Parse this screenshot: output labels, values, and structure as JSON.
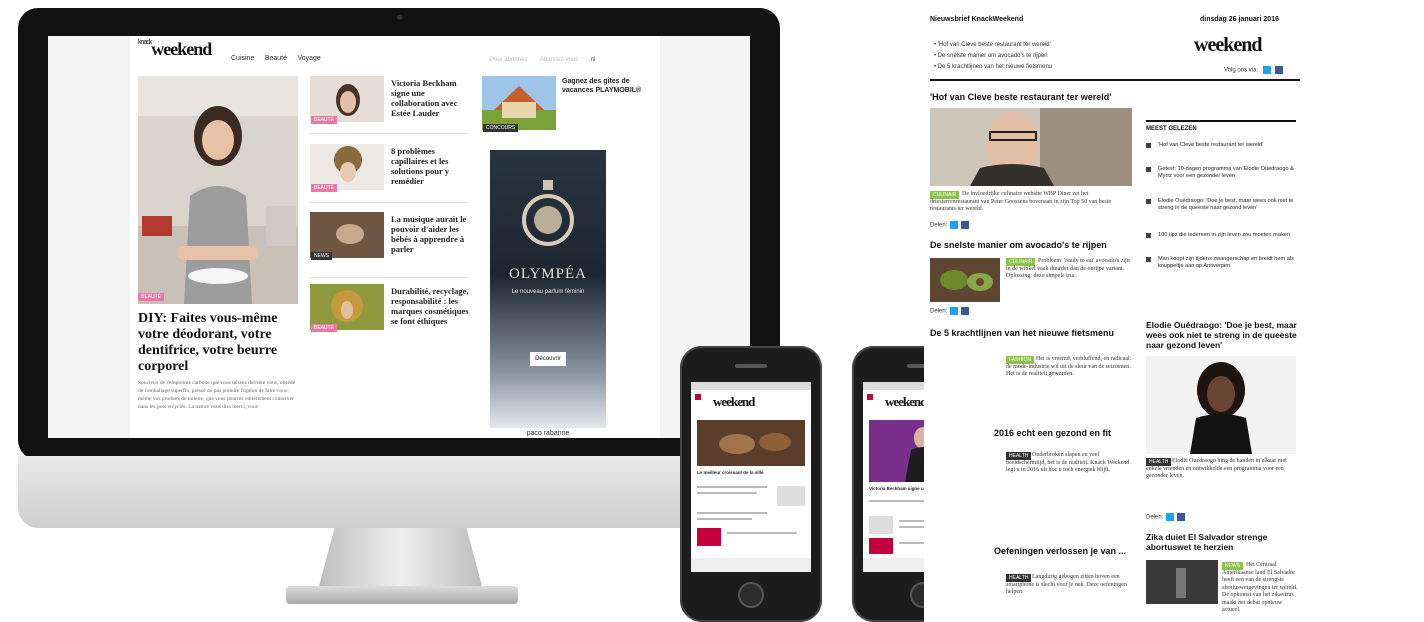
{
  "desktop": {
    "logo": "weekend",
    "logo_prefix": "knack",
    "nav": [
      "Cuisine",
      "Beauté",
      "Voyage"
    ],
    "header_right": [
      "Pour abonnés",
      "Abonnez-vous",
      "nl"
    ],
    "feature": {
      "tag": "BEAUTÉ",
      "title": "DIY: Faites vous-même votre déodorant, votre dentifrice, votre beurre corporel",
      "excerpt": "Soucieux de l'empreinte carbone que vous laissez derrière vous, obsédé de l'emballage superflu, pressé ou pas prendre l'option de faire vous-même vos produits de toilette, que vous pourrez entièrement conserver dans les pots recyclés. La nature vous dira merci, vous"
    },
    "items": [
      {
        "title": "Victoria Beckham signe une collaboration avec Estée Lauder",
        "tag": "BEAUTÉ"
      },
      {
        "title": "8 problèmes capillaires et les solutions pour y remédier",
        "tag": "BEAUTÉ"
      },
      {
        "title": "La musique aurait le pouvoir d'aider les bébés à apprendre à parler",
        "tag": "NEWS"
      },
      {
        "title": "Durabilité, recyclage, responsabilité : les marques cosmétiques se font éthiques",
        "tag": "BEAUTÉ"
      }
    ],
    "promo": {
      "title": "Gagnez des gîtes de vacances PLAYMOBIL®",
      "tag": "CONCOURS"
    },
    "ad": {
      "brand": "OLYMPÉA",
      "subtitle": "Le nouveau parfum féminin",
      "button": "Découvrir",
      "footer": "paco rabanne"
    }
  },
  "phone_left": {
    "logo": "weekend",
    "title": "Le meilleur croissant de la ville"
  },
  "phone_right": {
    "logo": "weekend",
    "title": "Victoria Beckham signe une collaboration"
  },
  "newsletter": {
    "title": "Nieuwsbrief KnackWeekend",
    "date": "dinsdag 26 januari 2016",
    "logo": "weekend",
    "follow": "Volg ons via:",
    "intro": [
      "'Hof van Cleve beste restaurant ter wereld'",
      "De snelste manier om avocado's te rijpen",
      "De 5 krachtlijnen van het nieuwe fietsmenu"
    ],
    "main": {
      "title": "'Hof van Cleve beste restaurant ter wereld'",
      "tag": "CULINAIR",
      "body": "De invloedrijke culinaire website WBP Diner zet het driesterrenrestaurant van Peter Goossens bovenaan in zijn Top 50 van beste restaurants ter wereld.",
      "share": "Delen:"
    },
    "avocado": {
      "title": "De snelste manier om avocado's te rijpen",
      "tag": "CULINAIR",
      "body": "Probleem: 'ready to eat' avocado's zijn in de winkel vaak duurder dan de onrijpe variant. Oplossing: deze simpele truc.",
      "share": "Delen:"
    },
    "fiets": {
      "title": "De 5 krachtlijnen van het nieuwe fietsmenu",
      "tag": "FASHION",
      "body": "Het is vreemd, verbluffend, en radicaal: de mode-industrie wil uit de sleur van de seizoenen. Het is de realiteit geworden."
    },
    "gezond": {
      "title": "2016 echt een gezond en fit",
      "tag": "HEALTH",
      "body": "Onderbroken slapen en veel beeldschermtijd, het is de realiteit. Knack Weekend legt u in 2016 uit hoe u toch energiek blijft."
    },
    "oefeningen": {
      "title": "Oefeningen verlossen je van ...",
      "tag": "HEALTH",
      "body": "Langdurig gebogen zitten boven een smartphone is slecht voor je nek. Deze oefeningen helpen."
    },
    "most_read": {
      "title": "MEEST GELEZEN",
      "items": [
        "'Hof van Cleve beste restaurant ter wereld'",
        "Getest: 10-dagen programma van Elodie Ouédraogo & Myrrz voor een gezonder leven",
        "Elodie Ouédraogo: 'Doe je best, maar wees ook niet te streng in de queeste naar gezond leven'",
        "100 tips die iedereen in zijn leven zou moeten maken",
        "Man koopt zijn tijdens zwangerschap en breidt hem als knuppeltje aan op Antwerpen"
      ]
    },
    "elodie": {
      "title": "Elodie Ouédraogo: 'Doe je best, maar wees ook niet te streng in de queeste naar gezond leven'",
      "tag": "HEALTH",
      "body": "Elodie Ouédraogo hing de handen in elkaar met enkele vrienden en ontwikkelde een programma voor een gezonder leven.",
      "share": "Delen:"
    },
    "zika": {
      "title": "Zika duiet El Salvador strenge abortuswet te herzien",
      "tag": "NEWS",
      "body": "Het Centraal Amerikaanse land El Salvador heeft een van de strengste abortuswetgevingen ter wereld. De opkomst van het zikavirus maakt het debat opnieuw actueel."
    }
  },
  "colors": {
    "accent": "#e77ba7",
    "bezel": "#111111",
    "facebook": "#3b5998",
    "twitter": "#1da1f2",
    "ad_bg": "#1f2a35"
  }
}
